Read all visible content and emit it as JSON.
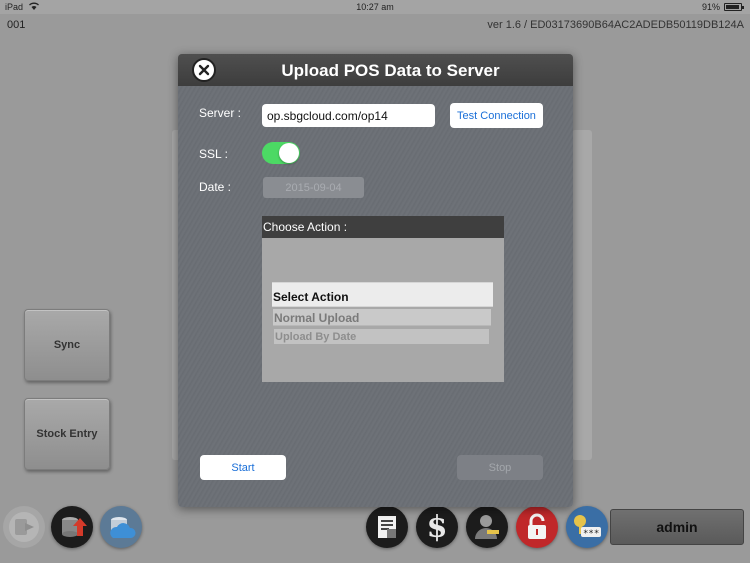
{
  "status_bar": {
    "carrier": "iPad",
    "time": "10:27 am",
    "battery_percent": "91%",
    "battery_level": 0.91
  },
  "header": {
    "left_id": "001",
    "version_info": "ver 1.6 / ED03173690B64AC2ADEDB50119DB124A"
  },
  "side_buttons": {
    "sync_label": "Sync",
    "stock_entry_label": "Stock Entry"
  },
  "dock": {
    "icons": [
      "sync-arrow-icon",
      "database-upload-icon",
      "cloud-database-icon",
      "report-icon",
      "dollar-icon",
      "user-key-icon",
      "lock-icon",
      "password-key-icon"
    ],
    "user": "admin"
  },
  "modal": {
    "title": "Upload POS Data to Server",
    "server_label": "Server :",
    "server_value": "op.sbgcloud.com/op14",
    "test_connection_label": "Test Connection",
    "ssl_label": "SSL :",
    "ssl_enabled": true,
    "date_label": "Date :",
    "date_value": "2015-09-04",
    "choose_action_label": "Choose Action :",
    "picker_options": [
      "Select Action",
      "Normal Upload",
      "Upload By Date"
    ],
    "selected_option": "Select Action",
    "start_label": "Start",
    "stop_label": "Stop"
  },
  "colors": {
    "toggle_on": "#4cd964",
    "link_blue": "#1a6fd8",
    "modal_header": "#444444"
  }
}
